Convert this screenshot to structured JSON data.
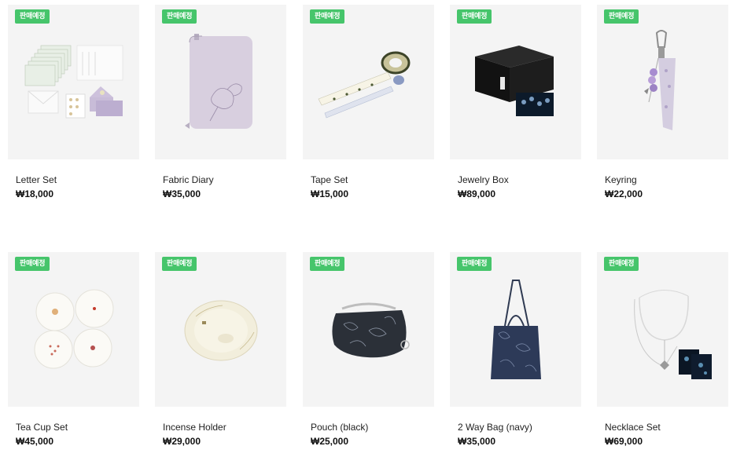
{
  "products": [
    {
      "name": "Letter Set",
      "price": "₩18,000",
      "badge": "판매예정",
      "icon": "letter-set-image"
    },
    {
      "name": "Fabric Diary",
      "price": "₩35,000",
      "badge": "판매예정",
      "icon": "fabric-diary-image"
    },
    {
      "name": "Tape Set",
      "price": "₩15,000",
      "badge": "판매예정",
      "icon": "tape-set-image"
    },
    {
      "name": "Jewelry Box",
      "price": "₩89,000",
      "badge": "판매예정",
      "icon": "jewelry-box-image"
    },
    {
      "name": "Keyring",
      "price": "₩22,000",
      "badge": "판매예정",
      "icon": "keyring-image"
    },
    {
      "name": "Tea Cup Set",
      "price": "₩45,000",
      "badge": "판매예정",
      "icon": "tea-cup-set-image"
    },
    {
      "name": "Incense Holder",
      "price": "₩29,000",
      "badge": "판매예정",
      "icon": "incense-holder-image"
    },
    {
      "name": "Pouch (black)",
      "price": "₩25,000",
      "badge": "판매예정",
      "icon": "pouch-image"
    },
    {
      "name": "2 Way Bag (navy)",
      "price": "₩35,000",
      "badge": "판매예정",
      "icon": "two-way-bag-image"
    },
    {
      "name": "Necklace Set",
      "price": "₩69,000",
      "badge": "판매예정",
      "icon": "necklace-set-image"
    }
  ],
  "colors": {
    "badge": "#46c56b",
    "card_bg": "#f4f4f4"
  }
}
